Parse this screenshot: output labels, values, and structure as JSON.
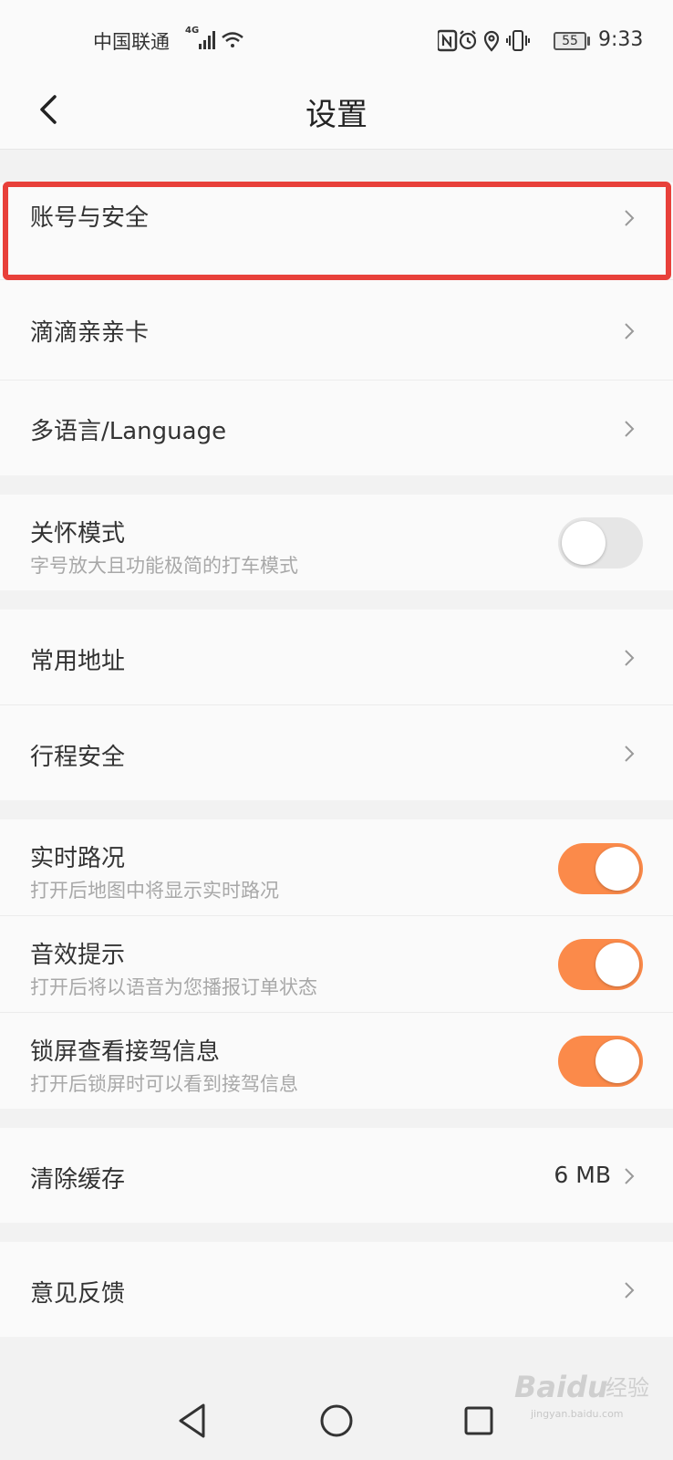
{
  "status_bar": {
    "carrier": "中国联通",
    "network": "4G",
    "time": "9:33",
    "battery_level": "55",
    "icons": [
      "signal-icon",
      "wifi-icon",
      "nfc-icon",
      "alarm-icon",
      "location-icon",
      "vibrate-icon",
      "battery-icon"
    ]
  },
  "header": {
    "title": "设置"
  },
  "settings": {
    "account_security": "账号与安全",
    "didi_family_card": "滴滴亲亲卡",
    "language": "多语言/Language",
    "care_mode": {
      "label": "关怀模式",
      "desc": "字号放大且功能极简的打车模式",
      "enabled": false
    },
    "common_address": "常用地址",
    "trip_safety": "行程安全",
    "realtime_traffic": {
      "label": "实时路况",
      "desc": "打开后地图中将显示实时路况",
      "enabled": true
    },
    "sound_prompt": {
      "label": "音效提示",
      "desc": "打开后将以语音为您播报订单状态",
      "enabled": true
    },
    "lockscreen_info": {
      "label": "锁屏查看接驾信息",
      "desc": "打开后锁屏时可以看到接驾信息",
      "enabled": true
    },
    "clear_cache": {
      "label": "清除缓存",
      "value": "6 MB"
    },
    "feedback": "意见反馈"
  },
  "watermark": {
    "brand": "Baidu",
    "cn": "经验",
    "url": "jingyan.baidu.com"
  },
  "colors": {
    "accent": "#fb8a4a",
    "highlight": "#e8403a",
    "toggle_off": "#e6e6e6"
  }
}
